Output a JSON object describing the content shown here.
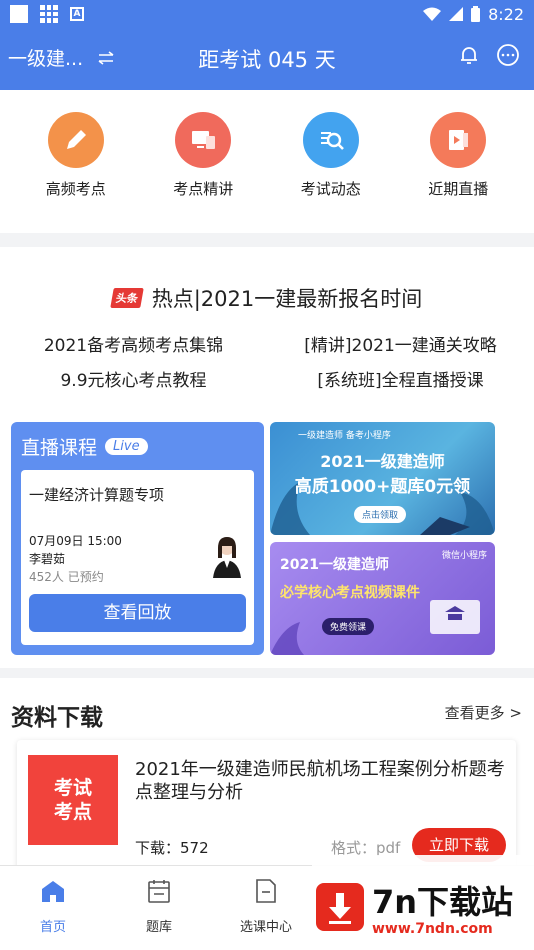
{
  "status_bar": {
    "time": "8:22"
  },
  "header": {
    "subject": "一级建...",
    "title": "距考试 045 天"
  },
  "quick_nav": [
    {
      "label": "高频考点",
      "icon": "pencil-icon",
      "color": "#f3924a"
    },
    {
      "label": "考点精讲",
      "icon": "screens-icon",
      "color": "#f06a5c"
    },
    {
      "label": "考试动态",
      "icon": "search-document-icon",
      "color": "#43a3ef"
    },
    {
      "label": "近期直播",
      "icon": "video-icon",
      "color": "#f47a5a"
    }
  ],
  "hot": {
    "badge": "头条",
    "headline": "热点|2021一建最新报名时间",
    "links": [
      "2021备考高频考点集锦",
      "[精讲]2021一建通关攻略",
      "9.9元核心考点教程",
      "[系统班]全程直播授课"
    ]
  },
  "live": {
    "heading": "直播课程",
    "tag": "Live",
    "course_title": "一建经济计算题专项",
    "time": "07月09日 15:00",
    "teacher": "李碧茹",
    "reservations": "452人 已预约",
    "button": "查看回放"
  },
  "banners": [
    {
      "small": "一级建造师 备考小程序",
      "line1": "2021一级建造师",
      "line2": "高质1000+题库0元领",
      "button": "点击领取"
    },
    {
      "small": "微信小程序",
      "line1": "2021一级建造师",
      "line2": "必学核心考点视频课件",
      "button": "免费领课"
    }
  ],
  "downloads": {
    "title": "资料下载",
    "more": "查看更多 >",
    "item": {
      "thumb_line1": "考试",
      "thumb_line2": "考点",
      "name": "2021年一级建造师民航机场工程案例分析题考点整理与分析",
      "count": "下载：572",
      "format": "格式：pdf",
      "button": "立即下载"
    }
  },
  "tabbar": [
    {
      "label": "首页",
      "icon": "home-icon",
      "active": true
    },
    {
      "label": "题库",
      "icon": "calendar-icon",
      "active": false
    },
    {
      "label": "选课中心",
      "icon": "document-icon",
      "active": false
    }
  ],
  "watermark": {
    "text": "7n下载站",
    "url": "www.7ndn.com"
  }
}
